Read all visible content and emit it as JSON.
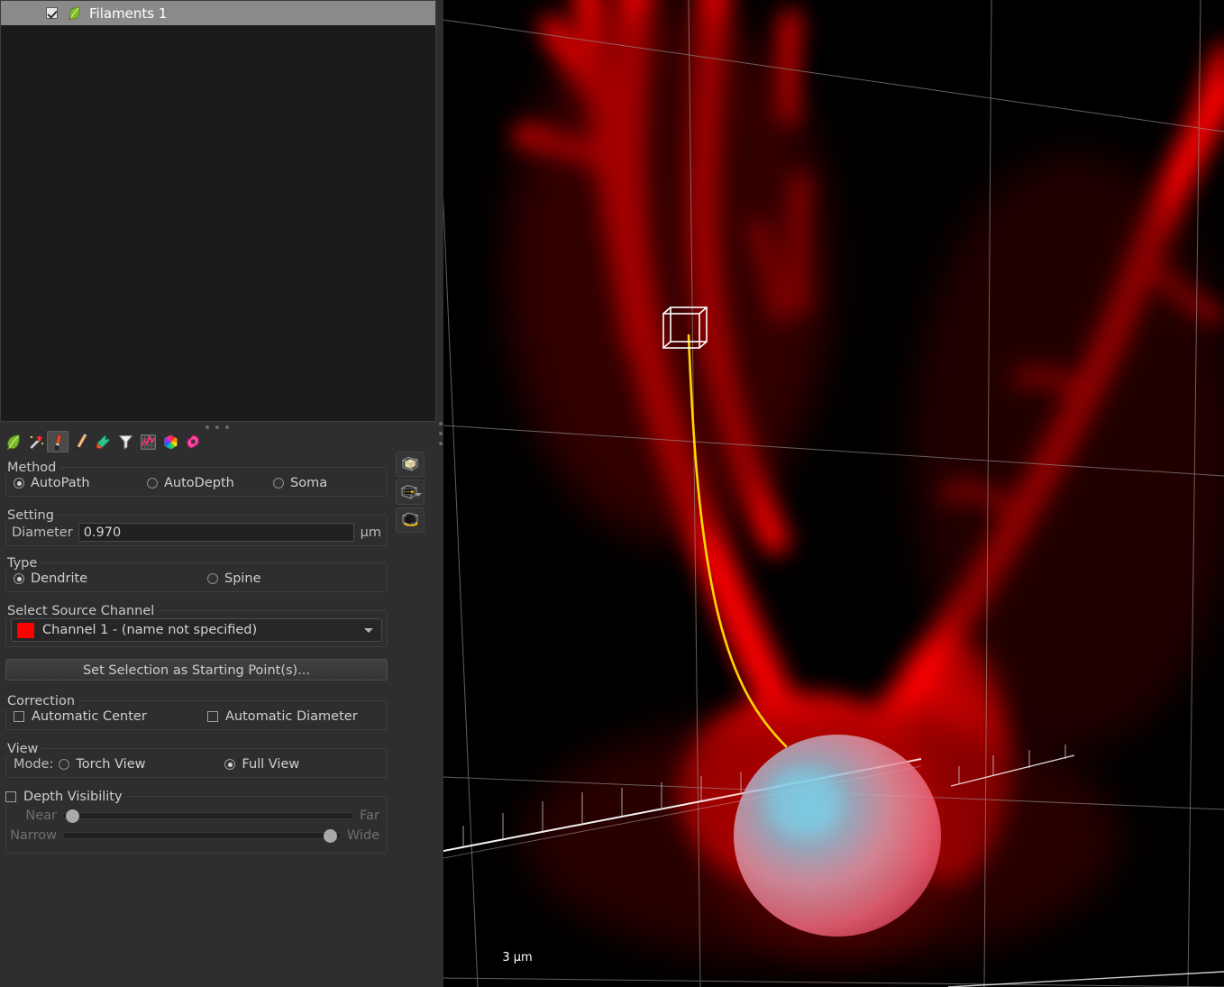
{
  "object_list": {
    "items": [
      {
        "label": "Filaments 1",
        "checked": true,
        "icon": "leaf-icon",
        "selected": true
      }
    ]
  },
  "toolbar": {
    "buttons": [
      {
        "name": "leaf-icon",
        "label": "Filament",
        "active": false
      },
      {
        "name": "magic-wand-icon",
        "label": "Autopath",
        "active": false
      },
      {
        "name": "paintbrush-icon",
        "label": "Draw",
        "active": true
      },
      {
        "name": "pencil-icon",
        "label": "Edit",
        "active": false
      },
      {
        "name": "tag-icon",
        "label": "Classify",
        "active": false
      },
      {
        "name": "funnel-icon",
        "label": "Filter",
        "active": false
      },
      {
        "name": "chart-icon",
        "label": "Statistics",
        "active": false
      },
      {
        "name": "color-wheel-icon",
        "label": "Color",
        "active": false
      },
      {
        "name": "gear-icon",
        "label": "Settings",
        "active": false
      }
    ]
  },
  "method": {
    "title": "Method",
    "options": [
      {
        "label": "AutoPath",
        "selected": true
      },
      {
        "label": "AutoDepth",
        "selected": false
      },
      {
        "label": "Soma",
        "selected": false
      }
    ]
  },
  "setting": {
    "title": "Setting",
    "diameter_label": "Diameter",
    "diameter_value": "0.970",
    "diameter_unit": "µm"
  },
  "type": {
    "title": "Type",
    "options": [
      {
        "label": "Dendrite",
        "selected": true
      },
      {
        "label": "Spine",
        "selected": false
      }
    ]
  },
  "source_channel": {
    "title": "Select Source Channel",
    "selected": "Channel 1 - (name not specified)",
    "swatch_color": "#ff0000",
    "options": [
      "Channel 1 - (name not specified)"
    ]
  },
  "actions": {
    "set_starting_points_label": "Set Selection as Starting Point(s)..."
  },
  "correction": {
    "title": "Correction",
    "options": [
      {
        "label": "Automatic Center",
        "checked": false
      },
      {
        "label": "Automatic Diameter",
        "checked": false
      }
    ]
  },
  "view": {
    "title": "View",
    "mode_label": "Mode:",
    "options": [
      {
        "label": "Torch View",
        "selected": false
      },
      {
        "label": "Full View",
        "selected": true
      }
    ]
  },
  "depth_visibility": {
    "title": "Depth Visibility",
    "checked": false,
    "sliders": [
      {
        "min_label": "Near",
        "max_label": "Far",
        "value_pct": 1
      },
      {
        "min_label": "Narrow",
        "max_label": "Wide",
        "value_pct": 97
      }
    ]
  },
  "view_buttons": [
    {
      "name": "frame-selection-icon",
      "has_caret": false
    },
    {
      "name": "view-direction-icon",
      "has_caret": true
    },
    {
      "name": "rotate-view-icon",
      "has_caret": false
    }
  ],
  "viewport": {
    "scale_bar_label": "3 µm",
    "background_color": "#000000",
    "channel_color": "#ff0000",
    "filament_trace_color": "#ffd800",
    "marker_color": "#ffffff",
    "soma_highlight_color": "#5ec8e8",
    "grid_color": "#9a9a9a"
  }
}
